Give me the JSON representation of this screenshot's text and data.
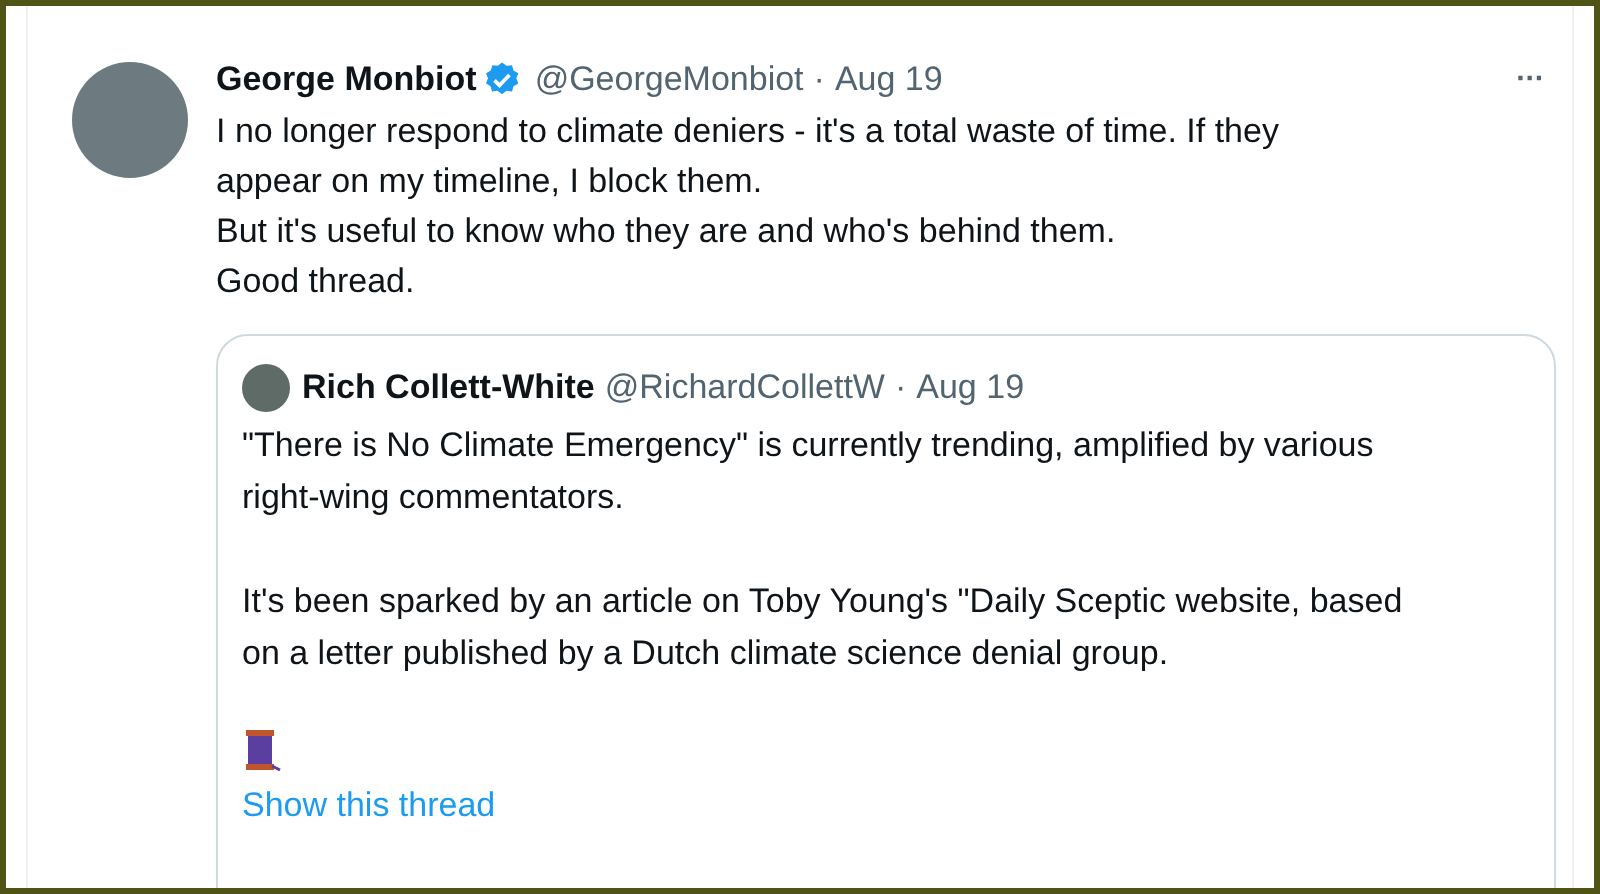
{
  "tweet": {
    "name": "George Monbiot",
    "verified": true,
    "handle": "@GeorgeMonbiot",
    "separator": "·",
    "date": "Aug 19",
    "more": "···",
    "lines": [
      "I no longer respond to climate deniers - it's a total waste of time. If they appear on my timeline, I block them.",
      "But it's useful to know who they are and who's behind them.",
      "Good thread."
    ],
    "quote": {
      "name": "Rich Collett-White",
      "handle": "@RichardCollettW",
      "separator": "·",
      "date": "Aug 19",
      "paragraphs": [
        "\"There is No Climate Emergency\" is currently trending, amplified by various right-wing commentators.",
        "It's been sparked by an article on Toby Young's \"Daily Sceptic website, based on a letter published by a Dutch climate science denial group."
      ],
      "link": "Show this thread"
    }
  }
}
